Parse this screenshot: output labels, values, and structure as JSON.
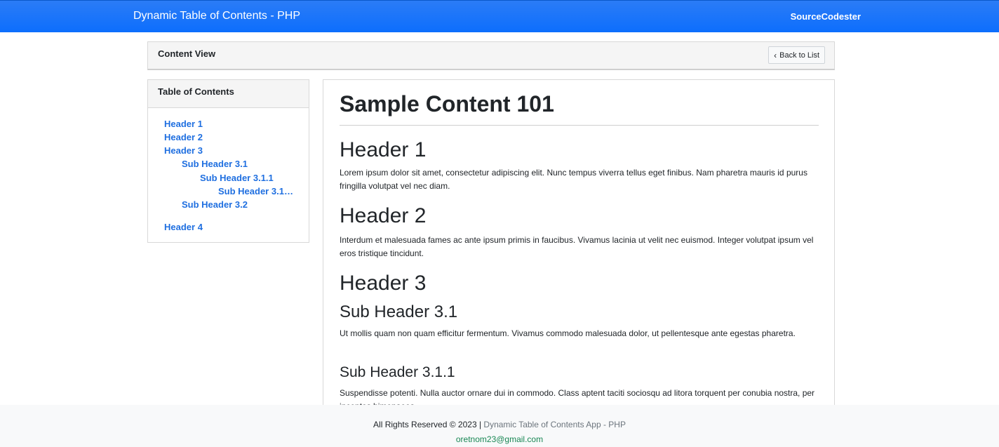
{
  "navbar": {
    "brand": "Dynamic Table of Contents - PHP",
    "right_link": "SourceCodester"
  },
  "content_header": {
    "title": "Content View",
    "back_button": "Back to List",
    "back_icon": "chevron-left-icon"
  },
  "toc": {
    "title": "Table of Contents",
    "items": [
      {
        "label": "Header 1",
        "level": 1
      },
      {
        "label": "Header 2",
        "level": 1
      },
      {
        "label": "Header 3",
        "level": 1
      },
      {
        "label": "Sub Header 3.1",
        "level": 2
      },
      {
        "label": "Sub Header 3.1.1",
        "level": 3
      },
      {
        "label": "Sub Header 3.1....",
        "level": 4
      },
      {
        "label": "Sub Header 3.2",
        "level": 2
      },
      {
        "label": "Header 4",
        "level": 1
      }
    ]
  },
  "article": {
    "title": "Sample Content 101",
    "sections": [
      {
        "heading": "Header 1",
        "text": "Lorem ipsum dolor sit amet, consectetur adipiscing elit. Nunc tempus viverra tellus eget finibus. Nam pharetra mauris id purus fringilla volutpat vel nec diam."
      },
      {
        "heading": "Header 2",
        "text": "Interdum et malesuada fames ac ante ipsum primis in faucibus. Vivamus lacinia ut velit nec euismod. Integer volutpat ipsum vel eros tristique tincidunt."
      },
      {
        "heading": "Header 3",
        "text": ""
      },
      {
        "heading": "Sub Header 3.1",
        "text": "Ut mollis quam non quam efficitur fermentum. Vivamus commodo malesuada dolor, ut pellentesque ante egestas pharetra."
      },
      {
        "heading": "Sub Header 3.1.1",
        "text": "Suspendisse potenti. Nulla auctor ornare dui in commodo. Class aptent taciti sociosqu ad litora torquent per conubia nostra, per inceptos himenaeos."
      }
    ]
  },
  "footer": {
    "rights": "All Rights Reserved © 2023 | ",
    "app_name": "Dynamic Table of Contents App - PHP",
    "email": "oretnom23@gmail.com"
  },
  "colors": {
    "navbar": "#0d6efd",
    "link": "#1f6fe0",
    "footer_email": "#198754"
  }
}
